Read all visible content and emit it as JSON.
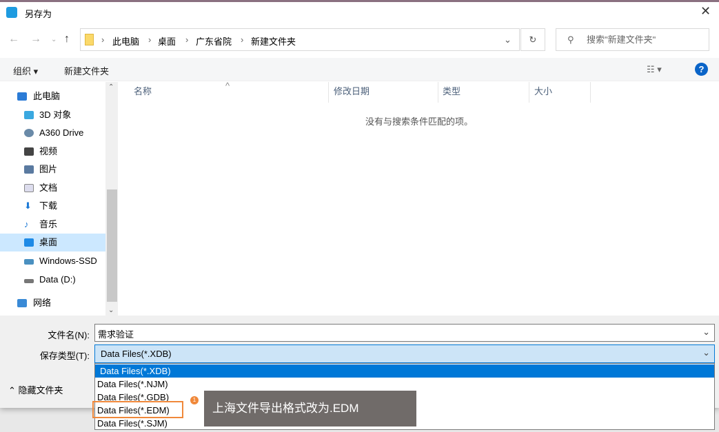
{
  "window": {
    "title": "另存为"
  },
  "address": {
    "crumbs": [
      "此电脑",
      "桌面",
      "广东省院",
      "新建文件夹"
    ],
    "search_placeholder": "搜索\"新建文件夹\""
  },
  "toolbar": {
    "organize": "组织 ▾",
    "new_folder": "新建文件夹",
    "help": "?"
  },
  "sidebar": [
    {
      "label": "此电脑",
      "color": "#2b7bd6"
    },
    {
      "label": "3D 对象",
      "color": "#3aa8e0"
    },
    {
      "label": "A360 Drive",
      "color": "#6a8aa8"
    },
    {
      "label": "视频",
      "color": "#444"
    },
    {
      "label": "图片",
      "color": "#5a7aa0"
    },
    {
      "label": "文档",
      "color": "#8aa"
    },
    {
      "label": "下载",
      "color": "#1e7ad6"
    },
    {
      "label": "音乐",
      "color": "#1e7ad6"
    },
    {
      "label": "桌面",
      "color": "#1e8ae6"
    },
    {
      "label": "Windows-SSD",
      "color": "#4a90c0"
    },
    {
      "label": "Data (D:)",
      "color": "#666"
    },
    {
      "label": "网络",
      "color": "#3a8ad6"
    }
  ],
  "columns": [
    "名称",
    "修改日期",
    "类型",
    "大小"
  ],
  "empty_message": "没有与搜索条件匹配的项。",
  "form": {
    "filename_label": "文件名(N):",
    "filename_value": "需求验证",
    "filetype_label": "保存类型(T):",
    "filetype_value": "Data Files(*.XDB)",
    "hide_folders": "隐藏文件夹"
  },
  "filetype_options": [
    "Data Files(*.XDB)",
    "Data Files(*.NJM)",
    "Data Files(*.GDB)",
    "Data Files(*.EDM)",
    "Data Files(*.SJM)"
  ],
  "annotation": {
    "badge": "1",
    "text": "上海文件导出格式改为.EDM"
  }
}
